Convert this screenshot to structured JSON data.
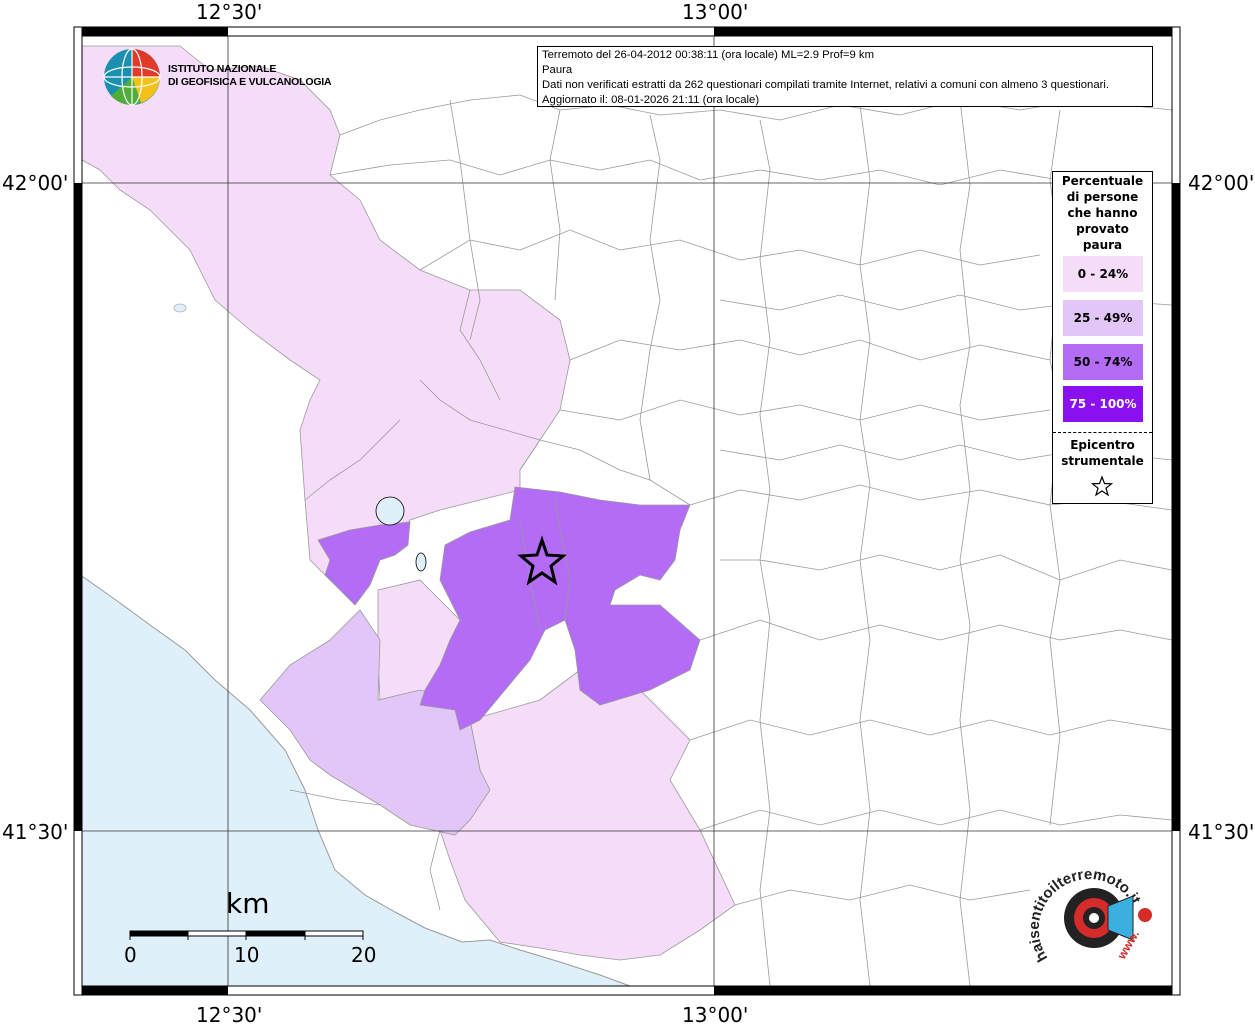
{
  "info": {
    "line1": "Terremoto del 26-04-2012 00:38:11 (ora locale) ML=2.9 Prof=9 km",
    "line2": "Paura",
    "line3": "Dati non verificati estratti da 262 questionari compilati tramite Internet, relativi a comuni con almeno 3 questionari.",
    "line4": "Aggiornato il: 08-01-2026 21:11 (ora locale)"
  },
  "coordinates": {
    "lon_left": "12°30'",
    "lon_right": "13°00'",
    "lat_top": "42°00'",
    "lat_bottom": "41°30'"
  },
  "legend": {
    "title": [
      "Percentuale",
      "di persone",
      "che hanno",
      "provato",
      "paura"
    ],
    "items": [
      {
        "label": "0 - 24%",
        "color": "#f5dcf8",
        "text_color": "#000000"
      },
      {
        "label": "25 - 49%",
        "color": "#e2c6f8",
        "text_color": "#000000"
      },
      {
        "label": "50 - 74%",
        "color": "#b46cf6",
        "text_color": "#000000"
      },
      {
        "label": "75 - 100%",
        "color": "#8a10f0",
        "text_color": "#ffffff"
      }
    ],
    "epicenter_label": [
      "Epicentro",
      "strumentale"
    ],
    "epicenter_icon": "star-icon"
  },
  "logo": {
    "org_line1": "ISTITUTO NAZIONALE",
    "org_line2": "DI GEOFISICA E VULCANOLOGIA",
    "icon": "globe-icon"
  },
  "scale": {
    "unit": "km",
    "ticks": [
      "0",
      "10",
      "20"
    ]
  },
  "site_logo": {
    "text": "haisentitoilterremoto.it",
    "www": "www.",
    "icon": "megaphone-icon"
  },
  "colors": {
    "sea": "#e0f0fb",
    "class_0_24": "#f5dcf8",
    "class_25_49": "#e2c6f8",
    "class_50_74": "#b46cf6",
    "class_75_100": "#8a10f0",
    "boundary": "#9a9a9a"
  }
}
